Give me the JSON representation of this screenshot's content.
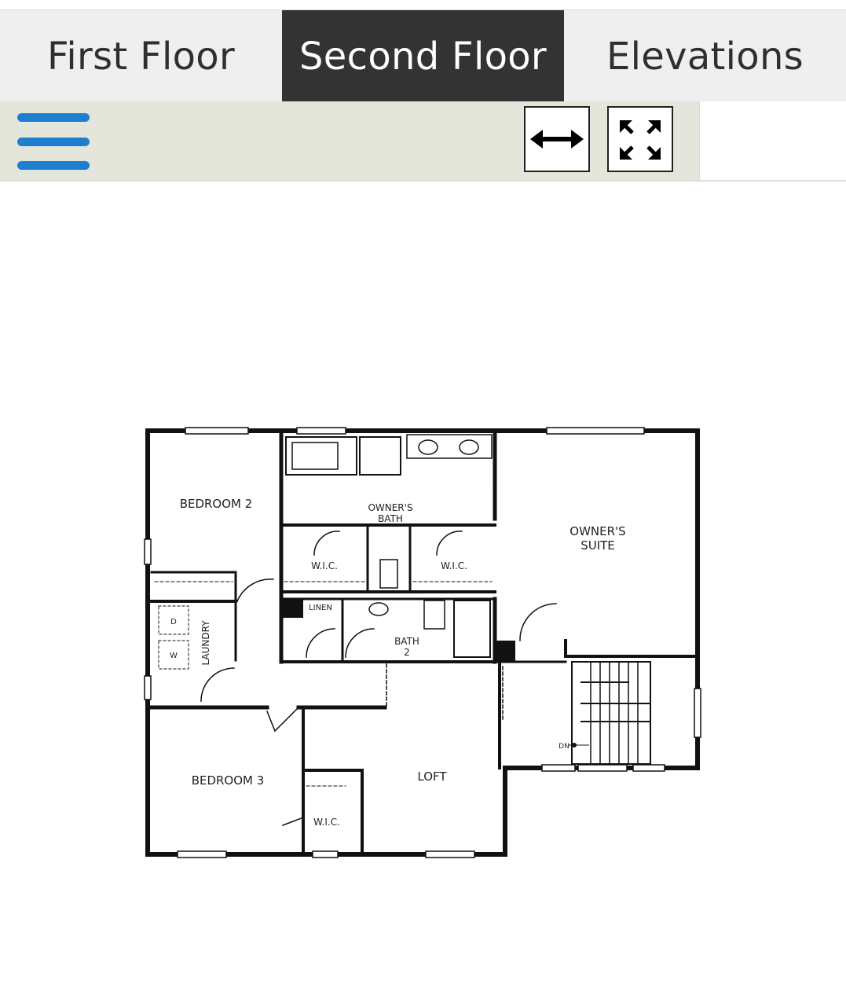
{
  "tabs": [
    {
      "label": "First Floor",
      "active": false
    },
    {
      "label": "Second Floor",
      "active": true
    },
    {
      "label": "Elevations",
      "active": false
    }
  ],
  "toolbar": {
    "menu_icon": "hamburger-menu-icon",
    "fit_width_icon": "double-arrow-horizontal-icon",
    "fullscreen_icon": "expand-arrows-icon",
    "menu_color": "#1e7fd0"
  },
  "floorplan": {
    "rooms": {
      "bedroom2": "BEDROOM 2",
      "owners_bath_1": "OWNER'S",
      "owners_bath_2": "BATH",
      "owners_suite_1": "OWNER'S",
      "owners_suite_2": "SUITE",
      "wic_left": "W.I.C.",
      "wic_right": "W.I.C.",
      "linen": "LINEN",
      "bath2_1": "BATH",
      "bath2_2": "2",
      "laundry": "LAUNDRY",
      "dryer": "D",
      "washer": "W",
      "bedroom3": "BEDROOM 3",
      "loft": "LOFT",
      "wic_small": "W.I.C.",
      "stairs_dn": "DN"
    }
  }
}
